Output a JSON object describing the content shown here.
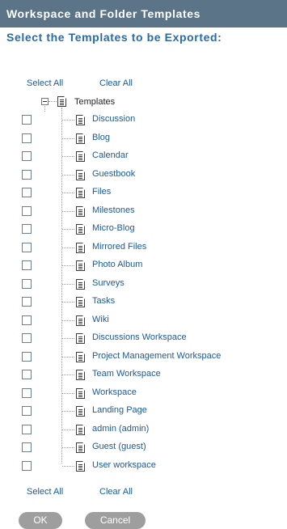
{
  "header": {
    "title": "Workspace and Folder Templates"
  },
  "subtitle": "Select the Templates to be Exported:",
  "top_links": {
    "select_all": "Select All",
    "clear_all": "Clear All"
  },
  "bottom_links": {
    "select_all": "Select All",
    "clear_all": "Clear All"
  },
  "tree": {
    "root_label": "Templates",
    "items": [
      {
        "label": "Discussion",
        "checked": false
      },
      {
        "label": "Blog",
        "checked": false
      },
      {
        "label": "Calendar",
        "checked": false
      },
      {
        "label": "Guestbook",
        "checked": false
      },
      {
        "label": "Files",
        "checked": false
      },
      {
        "label": "Milestones",
        "checked": false
      },
      {
        "label": "Micro-Blog",
        "checked": false
      },
      {
        "label": "Mirrored Files",
        "checked": false
      },
      {
        "label": "Photo Album",
        "checked": false
      },
      {
        "label": "Surveys",
        "checked": false
      },
      {
        "label": "Tasks",
        "checked": false
      },
      {
        "label": "Wiki",
        "checked": false
      },
      {
        "label": "Discussions Workspace",
        "checked": false
      },
      {
        "label": "Project Management Workspace",
        "checked": false
      },
      {
        "label": "Team Workspace",
        "checked": false
      },
      {
        "label": "Workspace",
        "checked": false
      },
      {
        "label": "Landing Page",
        "checked": false
      },
      {
        "label": "admin (admin)",
        "checked": false
      },
      {
        "label": "Guest (guest)",
        "checked": false
      },
      {
        "label": "User workspace",
        "checked": false
      }
    ]
  },
  "buttons": {
    "ok": "OK",
    "cancel": "Cancel"
  },
  "colors": {
    "header_bg": "#5b7488",
    "link": "#1a5aa0",
    "subtitle": "#2a6aa6",
    "button_bg": "#9e9e9e"
  }
}
